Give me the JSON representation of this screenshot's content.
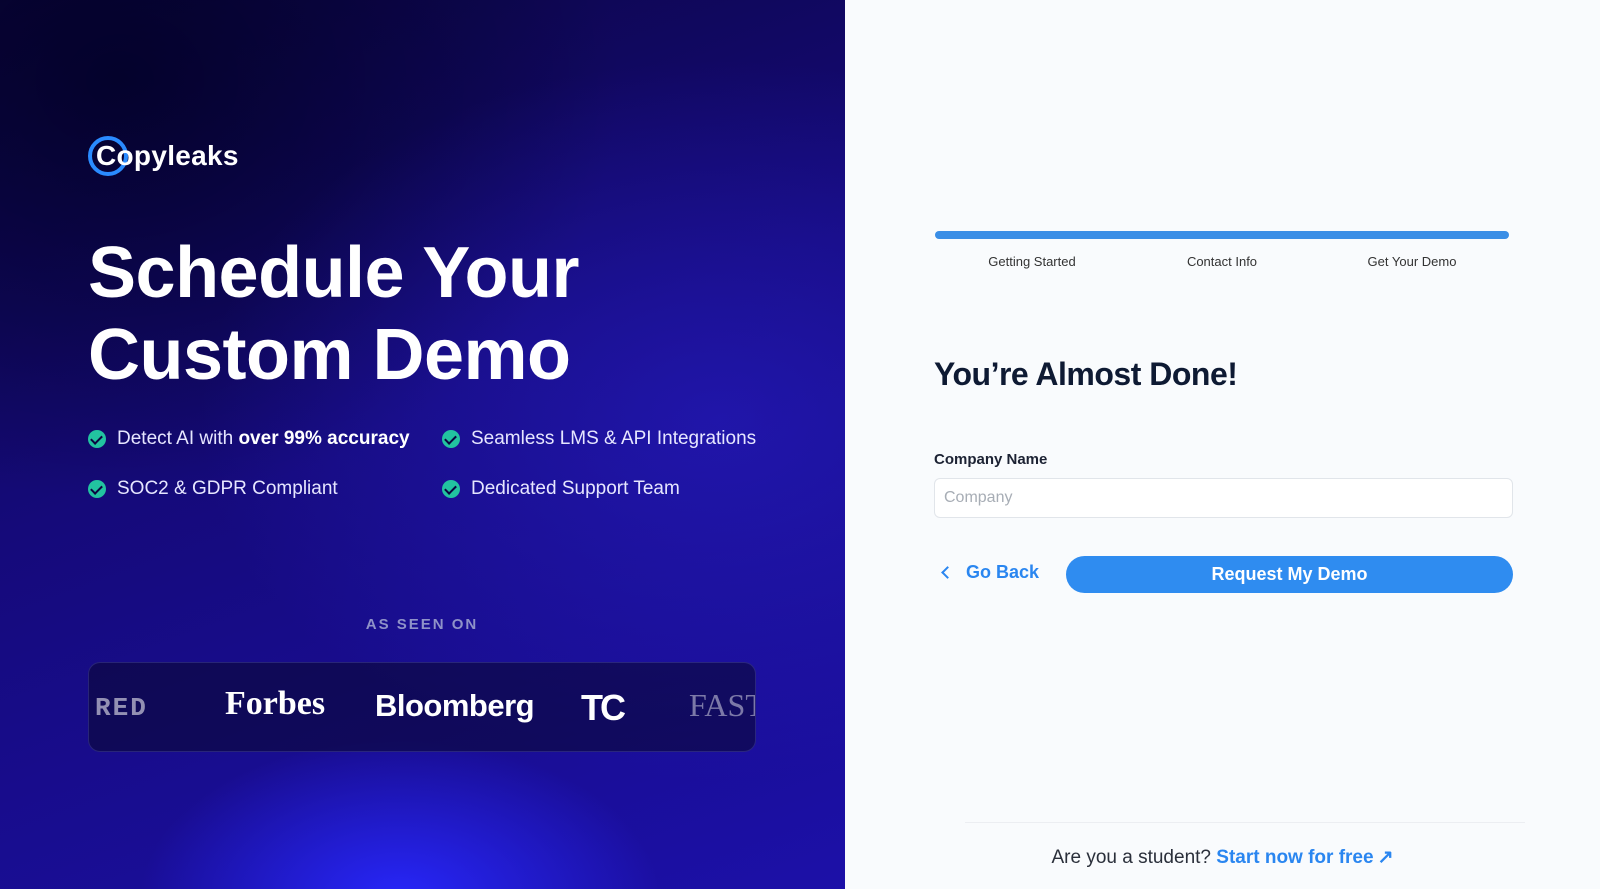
{
  "brand": {
    "name": "Copyleaks",
    "accent": "#2a8bff"
  },
  "hero": {
    "headline_line1": "Schedule Your",
    "headline_line2": "Custom Demo"
  },
  "features": [
    {
      "text_pre": "Detect AI with ",
      "text_bold": "over 99% accuracy"
    },
    {
      "text_pre": "Seamless LMS & API Integrations",
      "text_bold": ""
    },
    {
      "text_pre": "SOC2 & GDPR Compliant",
      "text_bold": ""
    },
    {
      "text_pre": "Dedicated Support Team",
      "text_bold": ""
    }
  ],
  "press": {
    "heading": "AS SEEN ON",
    "logos": [
      "RED",
      "Forbes",
      "Bloomberg",
      "TC",
      "FAST"
    ]
  },
  "progress": {
    "steps": [
      "Getting Started",
      "Contact Info",
      "Get Your Demo"
    ],
    "completed_fraction": 1.0,
    "color": "#3a8ee6"
  },
  "form": {
    "title": "You’re Almost Done!",
    "company_label": "Company Name",
    "company_placeholder": "Company",
    "company_value": "",
    "back_label": "Go Back",
    "submit_label": "Request My Demo",
    "submit_color": "#2f8cf0"
  },
  "footer": {
    "question": "Are you a student? ",
    "link_label": "Start now for free",
    "link_icon": "external-arrow-icon"
  }
}
